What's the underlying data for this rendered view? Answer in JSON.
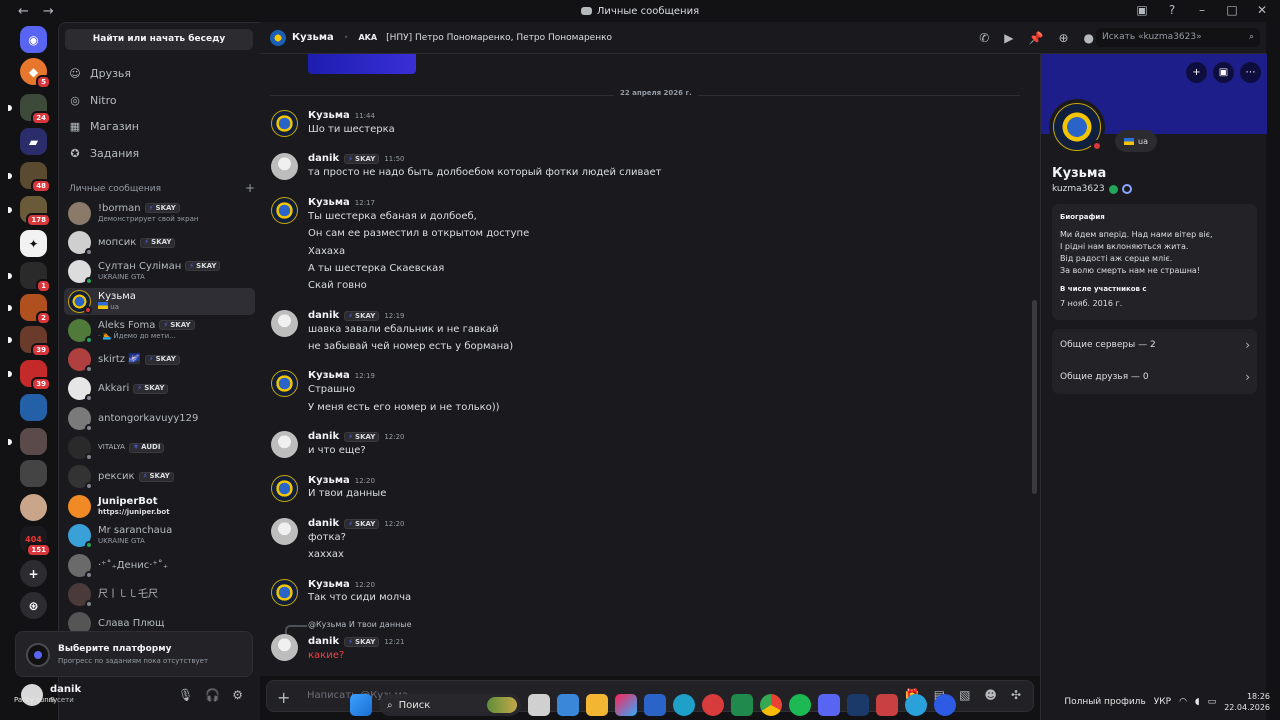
{
  "window": {
    "title": "Личные сообщения"
  },
  "sidebar": {
    "search_label": "Найти или начать беседу",
    "nav": [
      {
        "label": "Друзья",
        "icon": "friends-icon"
      },
      {
        "label": "Nitro",
        "icon": "nitro-icon"
      },
      {
        "label": "Магазин",
        "icon": "shop-icon"
      },
      {
        "label": "Задания",
        "icon": "quests-icon"
      }
    ],
    "dm_header": "Личные сообщения",
    "dm_add": "+",
    "dms": [
      {
        "name": "!borman",
        "tag": "SKAY",
        "sub": "Демонстрирует свой экран"
      },
      {
        "name": "мопсик",
        "tag": "SKAY",
        "sub": ""
      },
      {
        "name": "Султан Суліман",
        "tag": "SKAY",
        "sub": "UKRAINE GTA"
      },
      {
        "name": "Кузьма",
        "tag": "",
        "sub": "ua"
      },
      {
        "name": "Aleks Foma",
        "tag": "SKAY",
        "sub": "· 🏊 Йдемо до мети..."
      },
      {
        "name": "skirtz 🌌",
        "tag": "SKAY",
        "sub": ""
      },
      {
        "name": "Akkari",
        "tag": "SKAY",
        "sub": ""
      },
      {
        "name": "antongorkavuyy129",
        "tag": "",
        "sub": ""
      },
      {
        "name": "VITALYA",
        "tag": "AUDI",
        "sub": ""
      },
      {
        "name": "рексик",
        "tag": "SKAY",
        "sub": ""
      },
      {
        "name": "JuniperBot",
        "tag": "",
        "sub": "https://juniper.bot"
      },
      {
        "name": "Mr saranchaua",
        "tag": "",
        "sub": "UKRAINE GTA"
      },
      {
        "name": "‧⁺˚₊Денис‧⁺˚₊",
        "tag": "",
        "sub": ""
      },
      {
        "name": "尺丨㇄㇄乇尺",
        "tag": "",
        "sub": ""
      },
      {
        "name": "Слава Плющ",
        "tag": "",
        "sub": ""
      }
    ],
    "platform_card": {
      "title": "Выберите платформу",
      "subtitle": "Прогресс по заданиям пока отсутствует"
    },
    "user": {
      "name": "danik",
      "status": "В сети",
      "weather": "Partly sunny"
    }
  },
  "servers": {
    "badges": [
      "5",
      "24",
      "48",
      "178",
      "1",
      "2",
      "39",
      "39",
      "151"
    ]
  },
  "chat": {
    "name": "Кузьма",
    "aka_label": "AKA",
    "aka_names": "[НПУ] Петро Пономаренко, Петро Пономаренко",
    "search_placeholder": "Искать «kuzma3623»",
    "date_divider": "22 апреля 2026 г.",
    "messages": [
      {
        "author": "Кузьма",
        "time": "11:44",
        "lines": [
          "Шо ти шестерка"
        ]
      },
      {
        "author": "danik",
        "tag": "SKAY",
        "time": "11:50",
        "lines": [
          "та просто не надо быть долбоебом который фотки людей сливает"
        ]
      },
      {
        "author": "Кузьма",
        "time": "12:17",
        "lines": [
          "Ты шестерка ебаная и долбоеб,",
          "Он сам ее разместил в открытом доступе",
          "Хахаха",
          "А ты шестерка Скаевская",
          "Скай говно"
        ]
      },
      {
        "author": "danik",
        "tag": "SKAY",
        "time": "12:19",
        "lines": [
          "шавка завали ебальник и не гавкай",
          "не забывай чей номер есть у бормана)"
        ]
      },
      {
        "author": "Кузьма",
        "time": "12:19",
        "lines": [
          "Страшно",
          "У меня есть его номер и не только))"
        ]
      },
      {
        "author": "danik",
        "tag": "SKAY",
        "time": "12:20",
        "lines": [
          "и что еще?"
        ]
      },
      {
        "author": "Кузьма",
        "time": "12:20",
        "lines": [
          "И твои данные"
        ]
      },
      {
        "author": "danik",
        "tag": "SKAY",
        "time": "12:20",
        "lines": [
          "фотка?",
          "хаххах"
        ]
      },
      {
        "author": "Кузьма",
        "time": "12:20",
        "lines": [
          "Так что сиди молча"
        ]
      },
      {
        "author": "danik",
        "tag": "SKAY",
        "time": "12:21",
        "lines": [
          "какие?"
        ],
        "reply": "@Кузьма И твои данные"
      }
    ],
    "composer_placeholder": "Написать @Кузьма"
  },
  "profile": {
    "name": "Кузьма",
    "username": "kuzma3623",
    "status_bubble": "ua",
    "bio_label": "Биография",
    "bio_lines": [
      "Ми йдем вперід. Над нами вітер віє,",
      "І рідні нам вклоняються жита.",
      "Від радості аж серце мліє.",
      "За волю смерть нам не страшна!"
    ],
    "member_since_label": "В числе участников с",
    "member_since": "7 нояб. 2016 г.",
    "mutual_servers": "Общие серверы — 2",
    "mutual_friends": "Общие друзья — 0"
  },
  "taskbar": {
    "search_label": "Поиск",
    "full_profile": "Полный профиль",
    "lang": "УКР",
    "time": "18:26",
    "date": "22.04.2026"
  }
}
